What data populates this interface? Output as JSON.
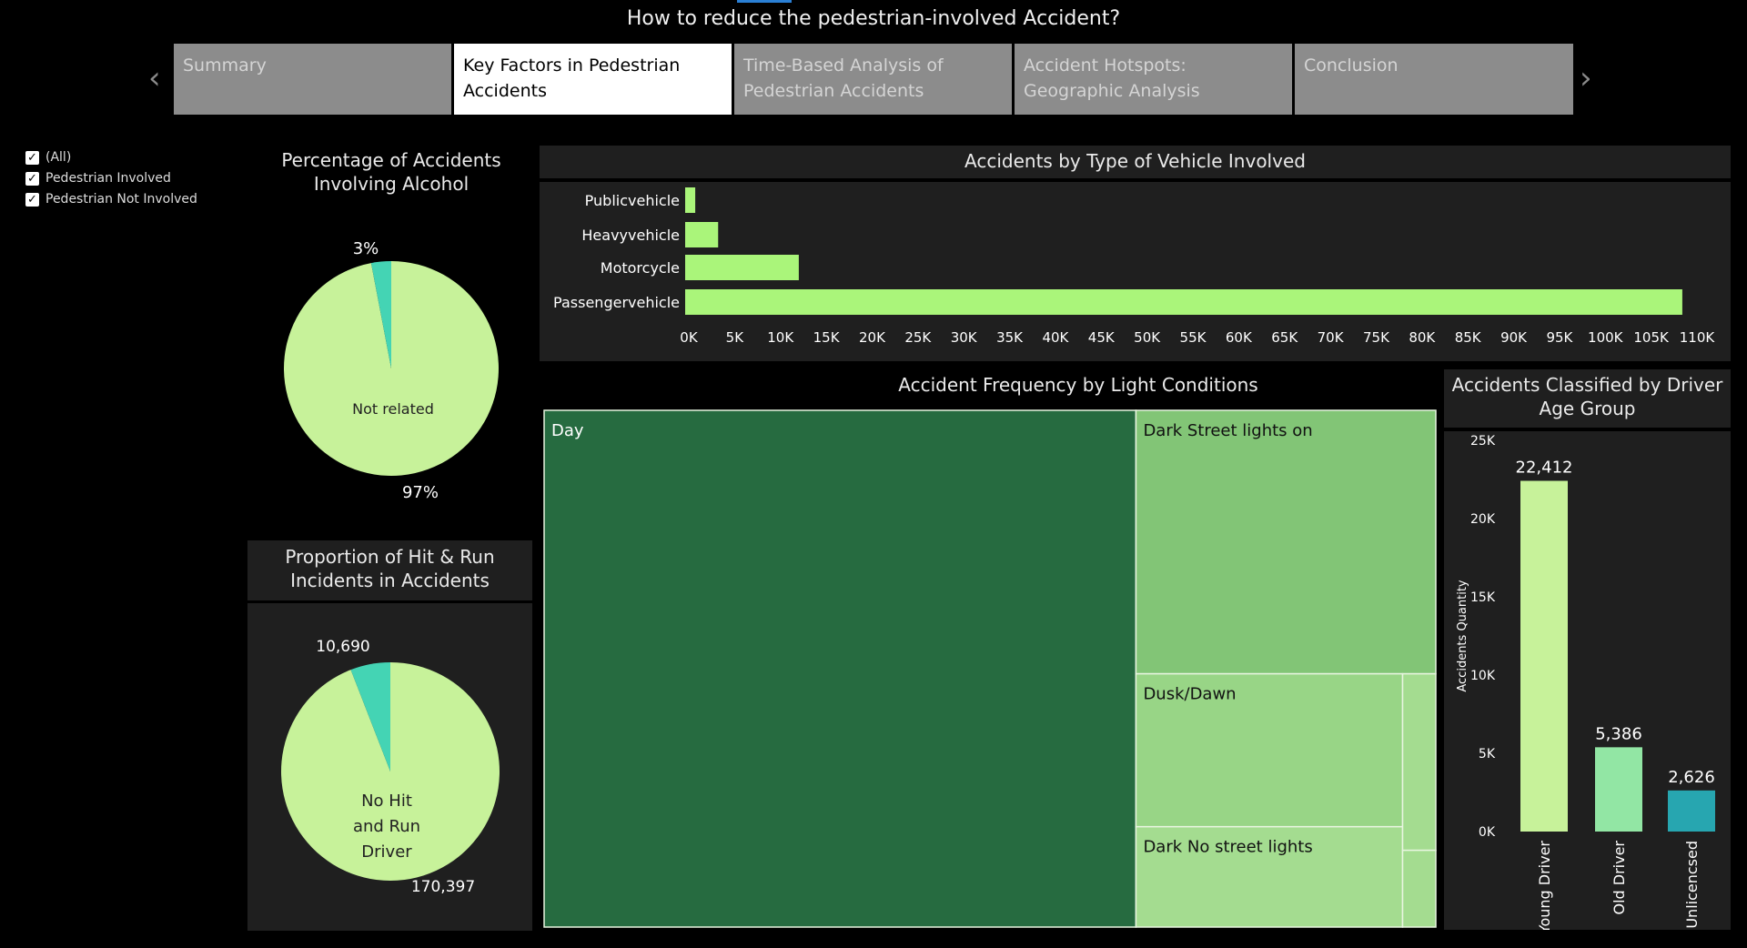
{
  "page_title": "How to reduce the pedestrian-involved Accident?",
  "tabs": [
    {
      "label": "Summary",
      "active": false
    },
    {
      "label": "Key Factors in Pedestrian Accidents",
      "active": true
    },
    {
      "label": "Time-Based Analysis of Pedestrian Accidents",
      "active": false
    },
    {
      "label": "Accident Hotspots: Geographic Analysis",
      "active": false
    },
    {
      "label": "Conclusion",
      "active": false
    }
  ],
  "nav": {
    "prev_glyph": "‹",
    "next_glyph": "›"
  },
  "filter": {
    "items": [
      {
        "label": "(All)",
        "checked": true
      },
      {
        "label": "Pedestrian Involved",
        "checked": true
      },
      {
        "label": "Pedestrian Not Involved",
        "checked": true
      }
    ]
  },
  "colors": {
    "pie_main": "#c7f29a",
    "pie_slice": "#44d4b4",
    "bar_green": "#aaf57a",
    "treemap_day": "#266b40",
    "treemap_street": "#82c576",
    "treemap_dusk": "#98d586",
    "treemap_dark": "#a4dc90",
    "age_young": "#c7f29a",
    "age_old": "#92e6a4",
    "age_unlicensed": "#27a6b0"
  },
  "chart_data": [
    {
      "id": "alcohol",
      "type": "pie",
      "title": "Percentage of Accidents Involving Alcohol",
      "slices": [
        {
          "name": "Not related",
          "value": 97,
          "label": "97%"
        },
        {
          "name": "",
          "value": 3,
          "label": "3%"
        }
      ]
    },
    {
      "id": "hitrun",
      "type": "pie",
      "title": "Proportion of Hit & Run Incidents in Accidents",
      "slices": [
        {
          "name": "No Hit and Run Driver",
          "value": 170397,
          "label": "170,397"
        },
        {
          "name": "",
          "value": 10690,
          "label": "10,690"
        }
      ]
    },
    {
      "id": "vehicle",
      "type": "bar",
      "orientation": "horizontal",
      "title": "Accidents by Type of Vehicle Involved",
      "categories": [
        "Publicvehicle",
        "Heavyvehicle",
        "Motorcycle",
        "Passengervehicle"
      ],
      "values": [
        1100,
        3600,
        12400,
        108800
      ],
      "xlim": [
        0,
        110000
      ],
      "ticks": [
        "0K",
        "5K",
        "10K",
        "15K",
        "20K",
        "25K",
        "30K",
        "35K",
        "40K",
        "45K",
        "50K",
        "55K",
        "60K",
        "65K",
        "70K",
        "75K",
        "80K",
        "85K",
        "90K",
        "95K",
        "100K",
        "105K",
        "110K"
      ]
    },
    {
      "id": "light",
      "type": "heatmap",
      "subtype": "treemap",
      "title": "Accident Frequency by Light Conditions",
      "items": [
        {
          "name": "Day",
          "value": 120000
        },
        {
          "name": "Dark Street lights on",
          "value": 31000
        },
        {
          "name": "Dusk/Dawn",
          "value": 16000
        },
        {
          "name": "Dark No street lights",
          "value": 10500
        },
        {
          "name": "",
          "value": 2300
        },
        {
          "name": "",
          "value": 1000
        }
      ]
    },
    {
      "id": "age",
      "type": "bar",
      "orientation": "vertical",
      "title": "Accidents Classified by Driver Age Group",
      "ylabel": "Accidents Quantity",
      "categories": [
        "Young Driver",
        "Old Driver",
        "Unlicencsed"
      ],
      "values": [
        22412,
        5386,
        2626
      ],
      "value_labels": [
        "22,412",
        "5,386",
        "2,626"
      ],
      "ylim": [
        0,
        25000
      ],
      "ticks": [
        {
          "value": 0,
          "label": "0K"
        },
        {
          "value": 5000,
          "label": "5K"
        },
        {
          "value": 10000,
          "label": "10K"
        },
        {
          "value": 15000,
          "label": "15K"
        },
        {
          "value": 20000,
          "label": "20K"
        },
        {
          "value": 25000,
          "label": "25K"
        }
      ]
    }
  ]
}
